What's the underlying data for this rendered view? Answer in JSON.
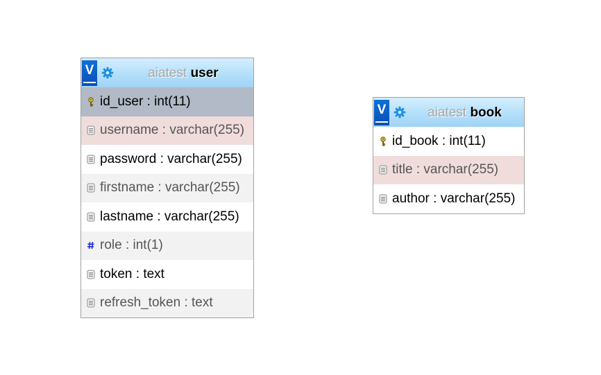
{
  "tables": [
    {
      "id": "user",
      "database": "aiatest",
      "name": "user",
      "toggle_label": "V",
      "columns": [
        {
          "text": "id_user : int(11)",
          "icon": "key-icon",
          "style": "pk"
        },
        {
          "text": "username : varchar(255)",
          "icon": "field-icon",
          "style": "unique"
        },
        {
          "text": "password : varchar(255)",
          "icon": "field-icon",
          "style": "plain"
        },
        {
          "text": "firstname : varchar(255)",
          "icon": "field-icon",
          "style": "alt"
        },
        {
          "text": "lastname : varchar(255)",
          "icon": "field-icon",
          "style": "plain"
        },
        {
          "text": "role : int(1)",
          "icon": "hash-icon",
          "style": "alt"
        },
        {
          "text": "token : text",
          "icon": "field-icon",
          "style": "plain"
        },
        {
          "text": "refresh_token : text",
          "icon": "field-icon",
          "style": "alt"
        }
      ]
    },
    {
      "id": "book",
      "database": "aiatest",
      "name": "book",
      "toggle_label": "V",
      "columns": [
        {
          "text": "id_book : int(11)",
          "icon": "key-icon",
          "style": "plain"
        },
        {
          "text": "title : varchar(255)",
          "icon": "field-icon",
          "style": "unique"
        },
        {
          "text": "author : varchar(255)",
          "icon": "field-icon",
          "style": "plain"
        }
      ]
    }
  ],
  "colors": {
    "header_gradient_top": "#d5efff",
    "header_gradient_bottom": "#9fd3f6",
    "toggle_blue": "#0a56c2",
    "gear_blue": "#1a8fe0",
    "primary_key_row": "#b1bac6",
    "unique_row": "#f1dcdc",
    "alt_row": "#f2f2f2",
    "hash_icon": "#1f2fd6"
  }
}
